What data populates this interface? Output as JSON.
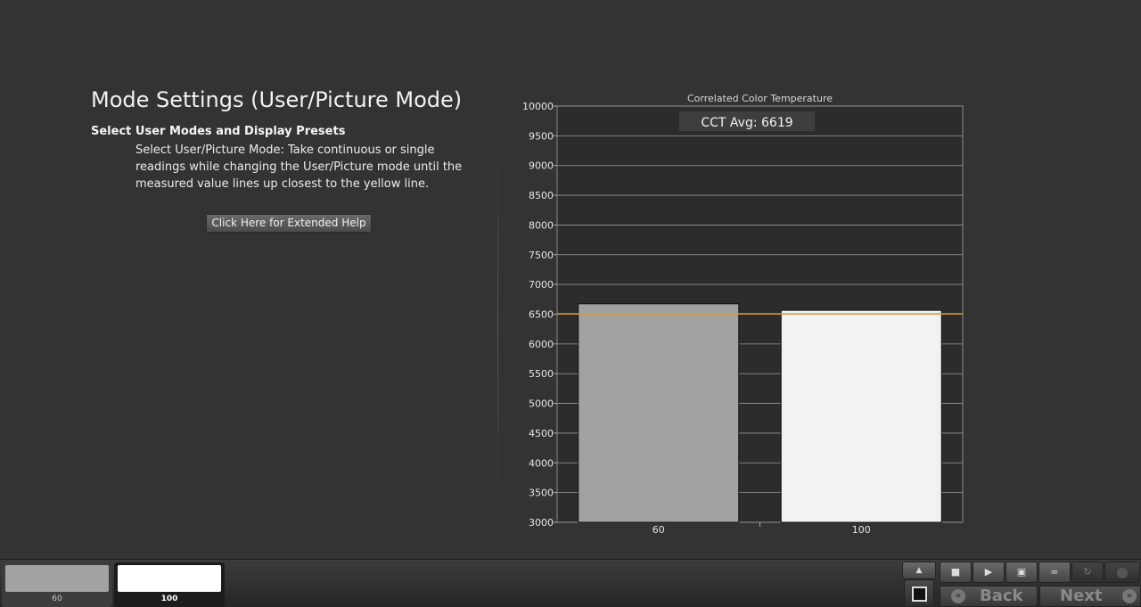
{
  "page": {
    "title": "Mode Settings (User/Picture Mode)",
    "subtitle": "Select User Modes and Display Presets",
    "description": "Select User/Picture Mode: Take continuous or single readings while changing the User/Picture mode until the measured value lines up closest to the yellow line.",
    "help_button": "Click Here for Extended Help"
  },
  "chart_data": {
    "type": "bar",
    "title": "Correlated Color Temperature",
    "annotation": "CCT Avg: 6619",
    "categories": [
      "60",
      "100"
    ],
    "values": [
      6675,
      6565
    ],
    "bar_colors": [
      "#a2a2a2",
      "#f2f2f2"
    ],
    "target_line": 6504,
    "target_line_color": "#d49a3a",
    "ylim": [
      3000,
      10000
    ],
    "yticks": [
      3000,
      3500,
      4000,
      4500,
      5000,
      5500,
      6000,
      6500,
      7000,
      7500,
      8000,
      8500,
      9000,
      9500,
      10000
    ],
    "xlabel": "",
    "ylabel": "",
    "grid": true
  },
  "swatches": [
    {
      "label": "60",
      "color": "#a3a3a3",
      "active": false
    },
    {
      "label": "100",
      "color": "#ffffff",
      "active": true
    }
  ],
  "controls": {
    "back_label": "Back",
    "next_label": "Next",
    "icons": [
      "up-arrow-icon",
      "stop-icon",
      "play-icon",
      "save-icon",
      "loop-icon",
      "refresh-icon",
      "record-icon",
      "stop-square-icon"
    ]
  }
}
